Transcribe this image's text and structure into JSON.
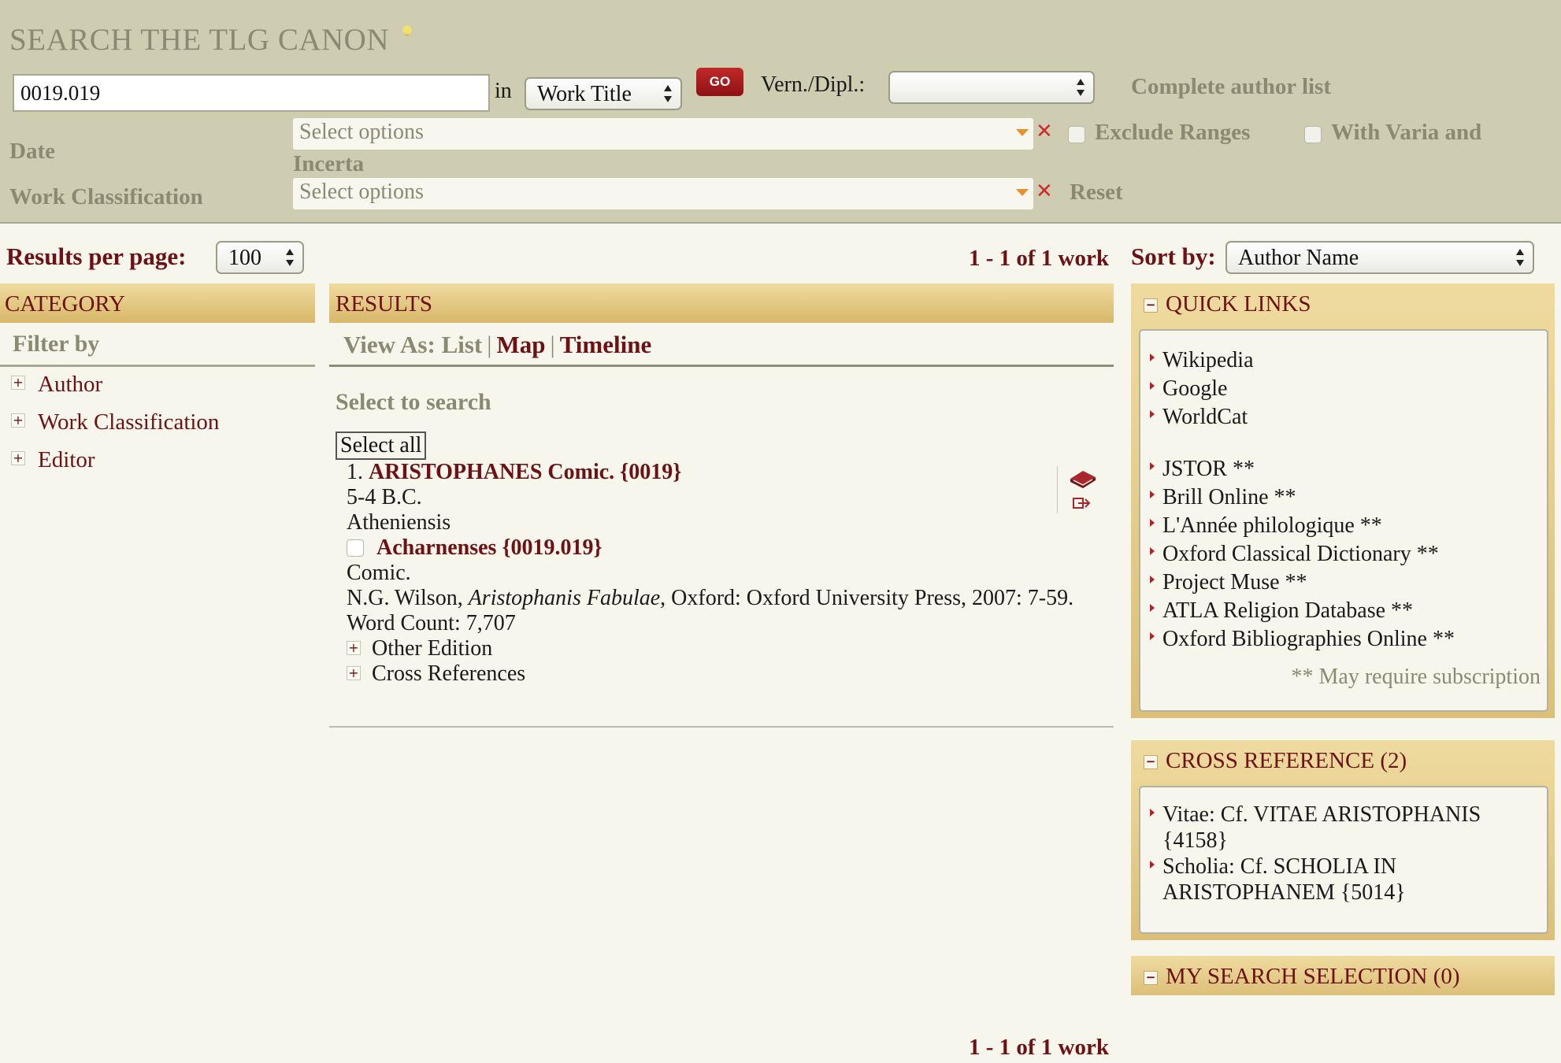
{
  "search": {
    "title": "SEARCH THE TLG CANON",
    "query_value": "0019.019",
    "in_label": "in",
    "field_select": "Work Title",
    "go_label": "GO",
    "vern_label": "Vern./Dipl.:",
    "vern_select": "",
    "complete_author_list": "Complete author list",
    "date_label": "Date",
    "date_placeholder": "Select options",
    "exclude_ranges": "Exclude Ranges",
    "with_varia": "With Varia and",
    "incerta": "Incerta",
    "work_class_label": "Work Classification",
    "work_class_placeholder": "Select options",
    "clear_glyph": "✕",
    "reset_label": "Reset"
  },
  "toolbar": {
    "results_per_page_label": "Results per page:",
    "results_per_page": "100",
    "count_text": "1 - 1 of 1 work",
    "sort_by_label": "Sort by:",
    "sort_by": "Author Name"
  },
  "category": {
    "header": "CATEGORY",
    "filter_by": "Filter by",
    "expand_glyph": "+",
    "items": [
      "Author",
      "Work Classification",
      "Editor"
    ]
  },
  "results": {
    "header": "RESULTS",
    "view_as_label": "View As:",
    "views": [
      "List",
      "Map",
      "Timeline"
    ],
    "separator": "|",
    "select_to_search": "Select to search",
    "select_all": "Select all",
    "items": [
      {
        "index": "1.",
        "author": "ARISTOPHANES Comic. {0019}",
        "date": "5-4 B.C.",
        "place": "Atheniensis",
        "work_title": "Acharnenses {0019.019}",
        "genre": "Comic.",
        "edition_editor": "N.G. Wilson,",
        "edition_title": "Aristophanis Fabulae",
        "edition_pub": ", Oxford: Oxford University Press, 2007: 7-59.",
        "word_count": "Word Count: 7,707",
        "other_edition": "Other Edition",
        "cross_references": "Cross References"
      }
    ],
    "bottom_count": "1 - 1 of 1 work"
  },
  "quick_links": {
    "header": "QUICK LINKS",
    "toggle_glyph": "−",
    "free_links": [
      "Wikipedia",
      "Google",
      "WorldCat"
    ],
    "subscription_links": [
      "JSTOR **",
      "Brill Online **",
      "L'Année philologique **",
      "Oxford Classical Dictionary **",
      "Project Muse **",
      "ATLA Religion Database **",
      "Oxford Bibliographies Online **"
    ],
    "note": "** May require subscription"
  },
  "cross_reference": {
    "header": "CROSS REFERENCE (2)",
    "items": [
      "Vitae: Cf. VITAE ARISTOPHANIS {4158}",
      "Scholia: Cf. SCHOLIA IN ARISTOPHANEM {5014}"
    ]
  },
  "my_selection": {
    "header": "MY SEARCH SELECTION (0)"
  },
  "colors": {
    "panel_bg": "#cecdb2",
    "page_bg": "#f7f6ec",
    "accent_dark_red": "#6d1114",
    "muted_label": "#8a8a72",
    "header_gold": "#d8b768",
    "go_button_red": "#b3212b"
  }
}
